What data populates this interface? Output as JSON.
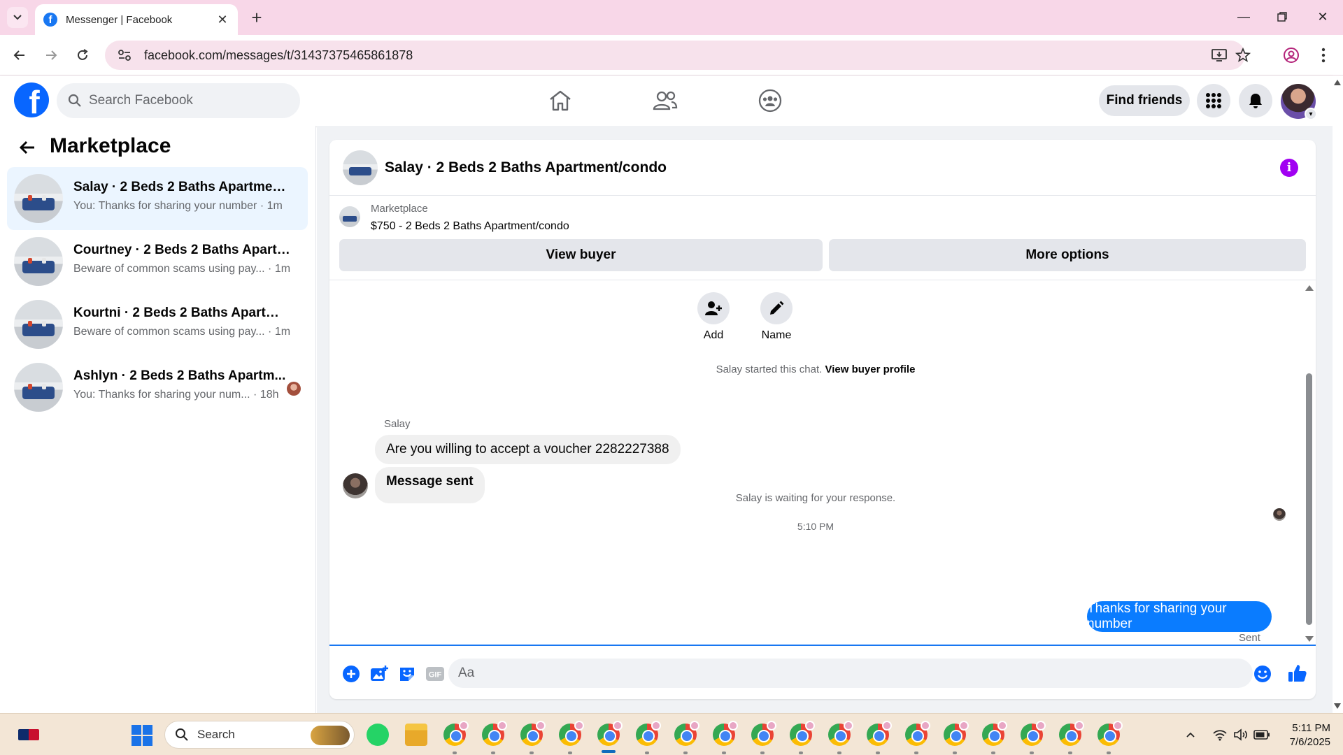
{
  "browser": {
    "tab_title": "Messenger | Facebook",
    "url": "facebook.com/messages/t/31437375465861878"
  },
  "fb": {
    "search_placeholder": "Search Facebook",
    "find_friends": "Find friends",
    "brand_color": "#0866ff"
  },
  "sidebar": {
    "title": "Marketplace",
    "conversations": [
      {
        "name": "Salay · 2 Beds 2 Baths Apartment/...",
        "preview": "You: Thanks for sharing your number · 1m",
        "active": true
      },
      {
        "name": "Courtney · 2 Beds 2 Baths Apartm...",
        "preview": "Beware of common scams using pay... · 1m",
        "active": false
      },
      {
        "name": "Kourtni · 2 Beds 2 Baths Apartmen...",
        "preview": "Beware of common scams using pay... · 1m",
        "active": false
      },
      {
        "name": "Ashlyn · 2 Beds 2 Baths Apartm...",
        "preview": "You: Thanks for sharing your num... · 18h",
        "active": false
      }
    ]
  },
  "chat": {
    "title": "Salay · 2 Beds 2 Baths Apartment/condo",
    "listing": {
      "label": "Marketplace",
      "price_title": "$750 - 2 Beds 2 Baths Apartment/condo",
      "view_buyer": "View buyer",
      "more_options": "More options"
    },
    "actions": {
      "add": "Add",
      "name": "Name"
    },
    "started_text": "Salay started this chat.",
    "view_buyer_profile": "View buyer profile",
    "sender": "Salay",
    "incoming": [
      "Are you willing to accept a voucher 2282227388",
      "Message sent"
    ],
    "waiting_text": "Salay is waiting for your response.",
    "timestamp": "5:10 PM",
    "outgoing": "Thanks for sharing your number",
    "sent_status": "Sent",
    "composer_placeholder": "Aa"
  },
  "taskbar": {
    "search": "Search",
    "time": "5:11 PM",
    "date": "7/6/2025"
  }
}
